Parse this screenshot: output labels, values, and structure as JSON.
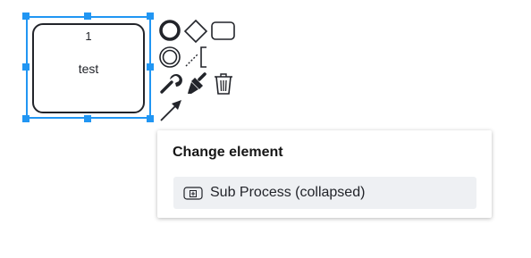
{
  "task": {
    "number": "1",
    "label": "test"
  },
  "context_pad": {
    "entries": [
      "end-event-icon",
      "gateway-icon",
      "task-icon",
      "intermediate-event-icon",
      "text-annotation-icon",
      "wrench-icon",
      "paintbrush-icon",
      "trash-icon",
      "connect-arrow-icon"
    ]
  },
  "popup": {
    "title": "Change element",
    "entries": [
      {
        "label": "Sub Process (collapsed)",
        "icon": "collapsed-subprocess-icon"
      }
    ]
  },
  "colors": {
    "selection": "#2196f3",
    "shape_stroke": "#22242a",
    "popup_entry_bg": "#eef0f3"
  }
}
